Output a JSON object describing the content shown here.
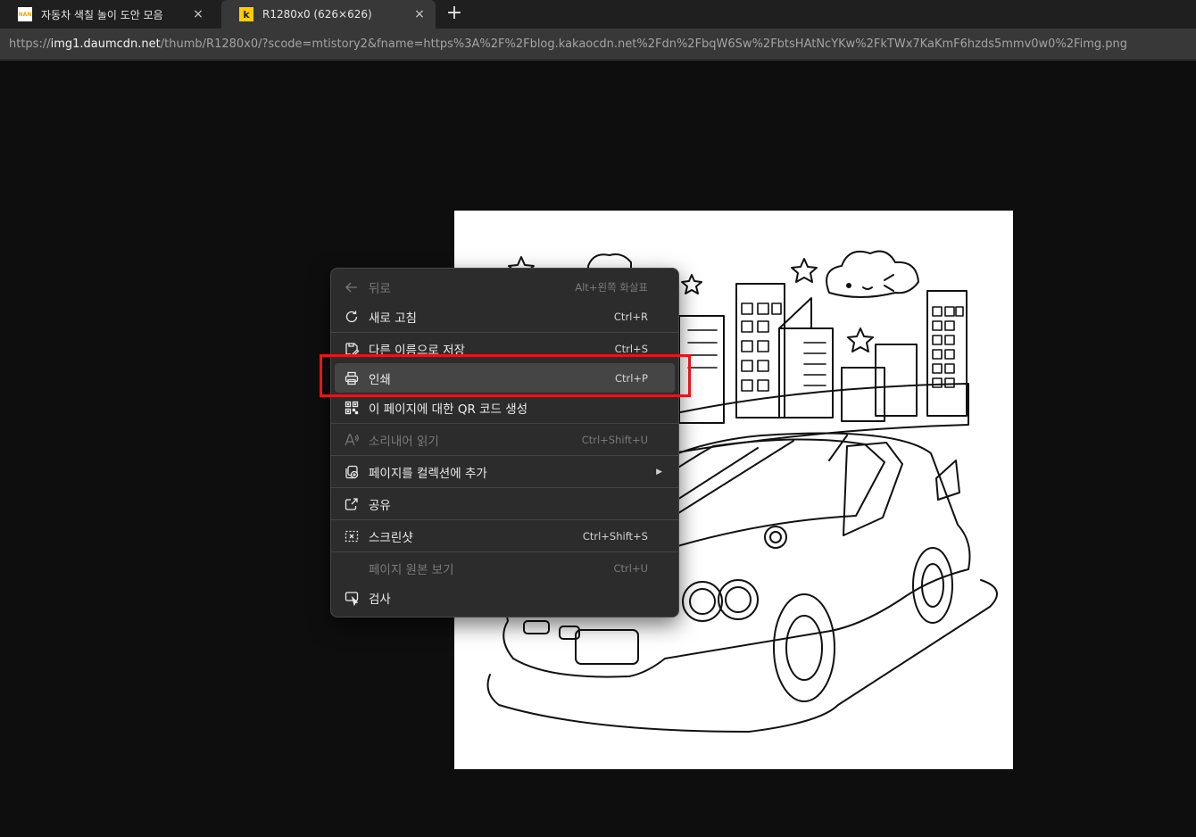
{
  "tabs": [
    {
      "title": "자동차 색칠 놀이 도안 모음",
      "favicon_text": "NAN",
      "close": "×",
      "active": false
    },
    {
      "title": "R1280x0 (626×626)",
      "favicon_text": "k",
      "close": "×",
      "active": true
    }
  ],
  "new_tab_symbol": "+",
  "address": {
    "scheme": "https://",
    "host": "img1.daumcdn.net",
    "rest": "/thumb/R1280x0/?scode=mtistory2&fname=https%3A%2F%2Fblog.kakaocdn.net%2Fdn%2FbqW6Sw%2FbtsHAtNcYKw%2FkTWx7KaKmF6hzds5mmv0w0%2Fimg.png"
  },
  "menu": {
    "items": [
      {
        "id": "back",
        "label": "뒤로",
        "shortcut": "Alt+왼쪽 화살표",
        "icon": "arrow-left-icon",
        "disabled": true,
        "separator_after": false
      },
      {
        "id": "refresh",
        "label": "새로 고침",
        "shortcut": "Ctrl+R",
        "icon": "refresh-icon",
        "disabled": false,
        "separator_after": true
      },
      {
        "id": "save-as",
        "label": "다른 이름으로 저장",
        "shortcut": "Ctrl+S",
        "icon": "save-as-icon",
        "disabled": false,
        "separator_after": false
      },
      {
        "id": "print",
        "label": "인쇄",
        "shortcut": "Ctrl+P",
        "icon": "printer-icon",
        "disabled": false,
        "highlighted": true,
        "separator_after": false
      },
      {
        "id": "qr",
        "label": "이 페이지에 대한 QR 코드 생성",
        "shortcut": "",
        "icon": "qr-code-icon",
        "disabled": false,
        "separator_after": true
      },
      {
        "id": "read-aloud",
        "label": "소리내어 읽기",
        "shortcut": "Ctrl+Shift+U",
        "icon": "read-aloud-icon",
        "disabled": true,
        "separator_after": true
      },
      {
        "id": "collections",
        "label": "페이지를 컬렉션에 추가",
        "shortcut": "",
        "icon": "collections-add-icon",
        "disabled": false,
        "submenu": true,
        "separator_after": true
      },
      {
        "id": "share",
        "label": "공유",
        "shortcut": "",
        "icon": "share-icon",
        "disabled": false,
        "separator_after": true
      },
      {
        "id": "screenshot",
        "label": "스크린샷",
        "shortcut": "Ctrl+Shift+S",
        "icon": "screenshot-icon",
        "disabled": false,
        "separator_after": true
      },
      {
        "id": "view-source",
        "label": "페이지 원본 보기",
        "shortcut": "Ctrl+U",
        "icon": "",
        "disabled": true,
        "separator_after": false
      },
      {
        "id": "inspect",
        "label": "검사",
        "shortcut": "",
        "icon": "inspect-icon",
        "disabled": false,
        "separator_after": false
      }
    ]
  },
  "colors": {
    "highlight_box": "#e8141b",
    "menu_bg": "#2c2c2c",
    "page_bg": "#0e0e0e"
  }
}
